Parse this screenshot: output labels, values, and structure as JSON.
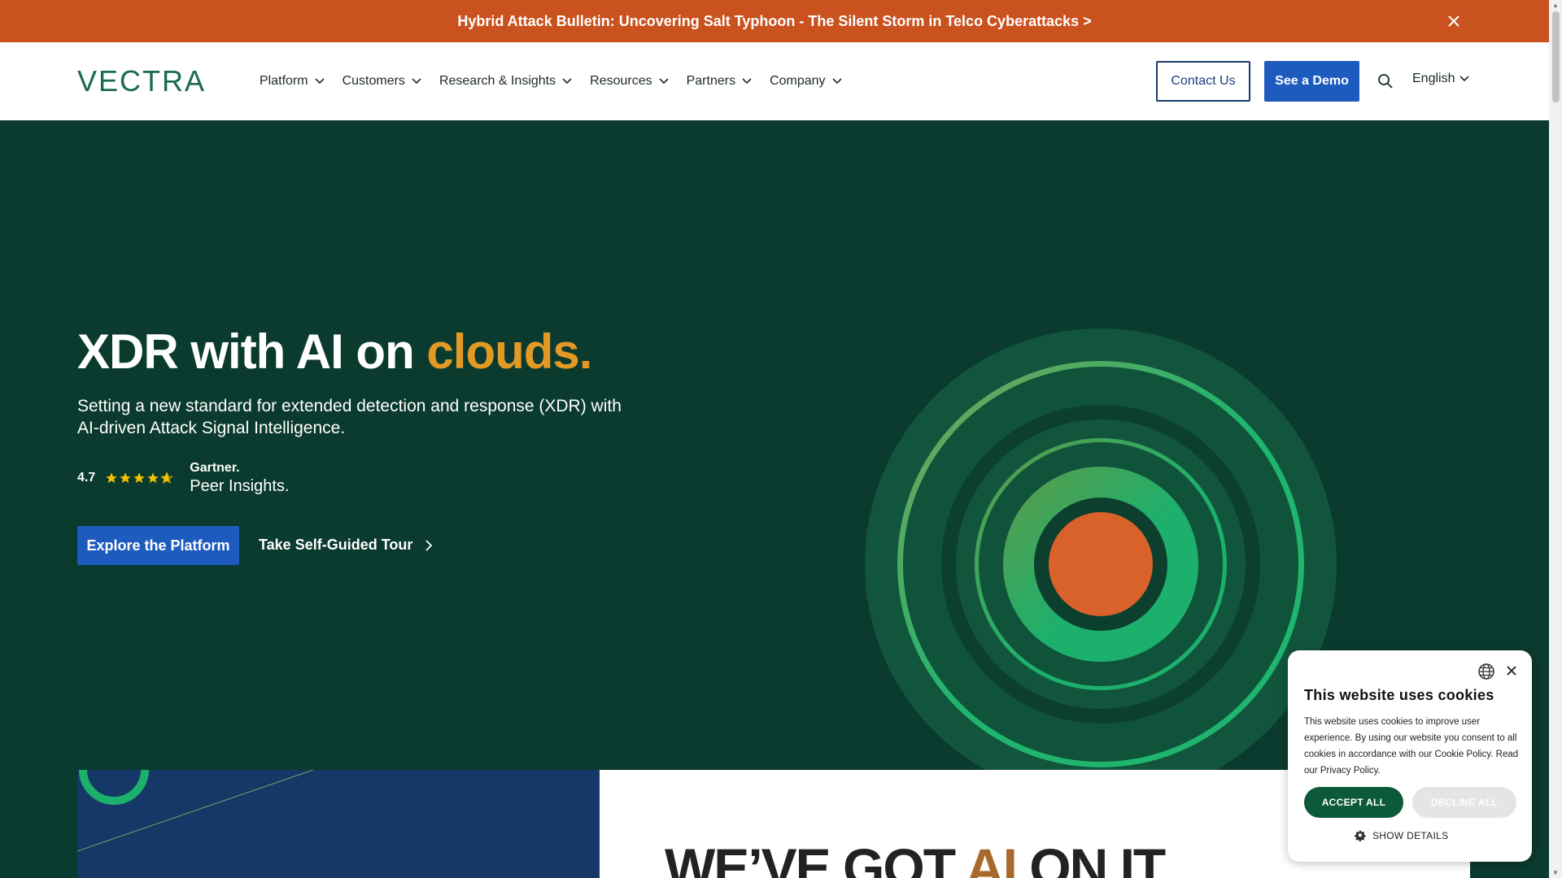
{
  "bulletin": {
    "text": "Hybrid Attack Bulletin:  Uncovering Salt Typhoon - The Silent Storm in Telco Cyberattacks >"
  },
  "header": {
    "logo_text": "VECTRA",
    "nav": [
      {
        "label": "Platform"
      },
      {
        "label": "Customers"
      },
      {
        "label": "Research & Insights"
      },
      {
        "label": "Resources"
      },
      {
        "label": "Partners"
      },
      {
        "label": "Company"
      }
    ],
    "contact_label": "Contact Us",
    "demo_label": "See a Demo",
    "language": "English"
  },
  "hero": {
    "title_main": "XDR with AI on ",
    "title_accent": "clouds.",
    "subtitle": "Setting a new standard for extended detection and response (XDR) with AI-driven Attack Signal Intelligence.",
    "rating_score": "4.7",
    "rating_stars": 4.7,
    "gartner_line1": "Gartner.",
    "gartner_line2": "Peer Insights.",
    "explore_label": "Explore the Platform",
    "tour_label": "Take Self-Guided Tour"
  },
  "section2": {
    "headline_pre": "WE’VE GOT ",
    "headline_ai": "AI",
    "headline_post": " ON IT"
  },
  "cookie": {
    "title": "This website uses cookies",
    "body": "This website uses cookies to improve user experience. By using our website you consent to all cookies in accordance with our Cookie Policy. Read our Privacy Policy.",
    "accept_label": "ACCEPT ALL",
    "decline_label": "DECLINE ALL",
    "details_label": "SHOW DETAILS"
  },
  "colors": {
    "bulletin_bg": "#c9521f",
    "hero_bg": "#0b3a2e",
    "primary_blue": "#1e5bbf",
    "accent_orange": "#e39a25",
    "ring_green": "#1db06c",
    "core_orange": "#d9622b",
    "cookie_green": "#0d5a3b"
  },
  "icons": {
    "bulletin_close": "close-icon",
    "nav_chevron": "chevron-down-icon",
    "search": "search-icon",
    "cookie_globe": "globe-icon",
    "cookie_close": "close-icon",
    "cookie_details": "gear-icon",
    "tour_arrow": "chevron-right-icon",
    "stars": "star-icon"
  }
}
